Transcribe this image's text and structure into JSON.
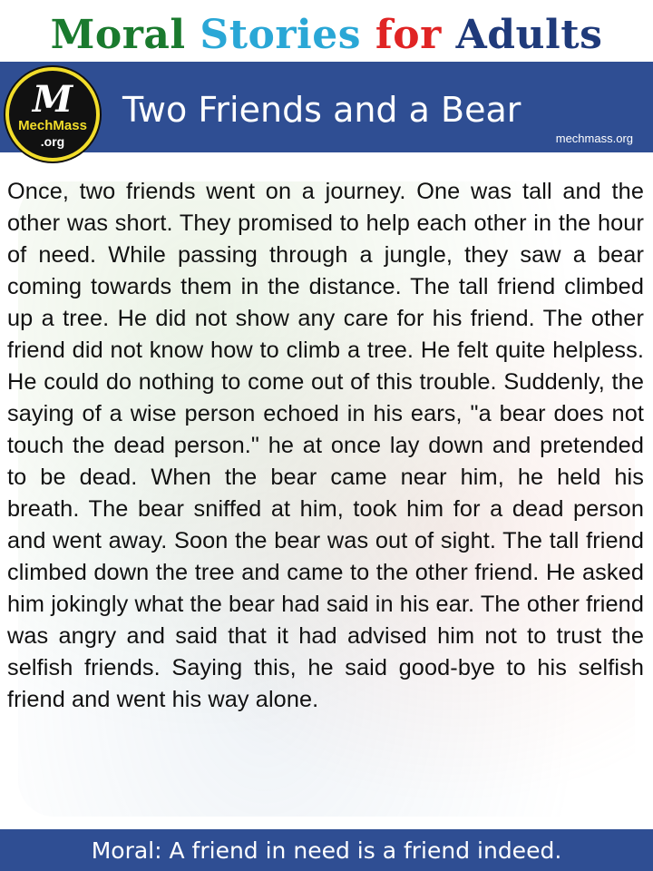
{
  "header": {
    "title_parts": [
      {
        "text": "Moral ",
        "color": "#1a7a2e"
      },
      {
        "text": "Stories ",
        "color": "#2aa7d6"
      },
      {
        "text": "for ",
        "color": "#e02424"
      },
      {
        "text": "Adults",
        "color": "#1f3a7a"
      }
    ]
  },
  "banner": {
    "logo": {
      "mark": "M",
      "name": "MechMass",
      "org": ".org"
    },
    "story_title": "Two Friends and a Bear",
    "site_url": "mechmass.org"
  },
  "story": {
    "text": "Once, two friends went on a journey. One was tall and the other was short. They promised to help each other in the hour of need. While passing through a jungle, they saw a bear coming towards them in the distance. The tall friend climbed up a tree. He did not show any care for his friend. The other friend did not know how to climb a tree. He felt quite helpless. He could do nothing to come out of this trouble. Suddenly, the saying of a wise person echoed in his ears, \"a bear does not touch the dead person.\" he at once lay down and pretended to be dead. When the bear came near him, he held his breath. The bear sniffed at him, took him for a dead person and went away. Soon the bear was out of sight. The tall friend climbed down the tree and came to the other friend. He asked him jokingly what the bear had said in his ear. The other friend was angry and said that it had advised him not to trust the selfish friends. Saying this, he said good-bye to his selfish friend and went his way alone."
  },
  "footer": {
    "moral": "Moral: A friend in need is a friend indeed."
  },
  "colors": {
    "banner_blue": "#2f4e93",
    "logo_ring_yellow": "#f2dd2a"
  }
}
